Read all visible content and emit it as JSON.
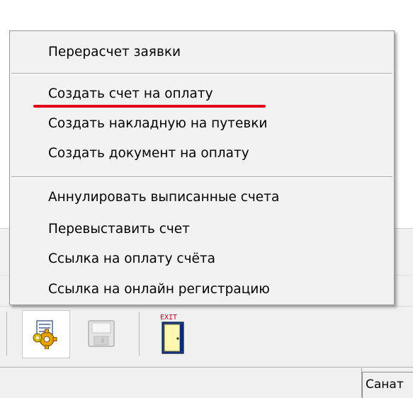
{
  "context_menu": {
    "items": [
      {
        "label": "Перерасчет заявки"
      },
      {
        "label": "Создать счет на оплату"
      },
      {
        "label": "Создать накладную на путевки"
      },
      {
        "label": "Создать документ на оплату"
      },
      {
        "label": "Аннулировать выписанные счета"
      },
      {
        "label": "Перевыставить счет"
      },
      {
        "label": "Ссылка на оплату счёта"
      },
      {
        "label": "Ссылка на онлайн регистрацию"
      }
    ],
    "highlighted_item": "Создать счет на оплату",
    "highlight_color": "#e3051b"
  },
  "toolbar": {
    "icons": [
      "settings-gear-icon",
      "save-disk-icon",
      "exit-door-icon"
    ],
    "exit_icon_text": "EXIT"
  },
  "statusbar": {
    "cell_text": "Санат"
  }
}
